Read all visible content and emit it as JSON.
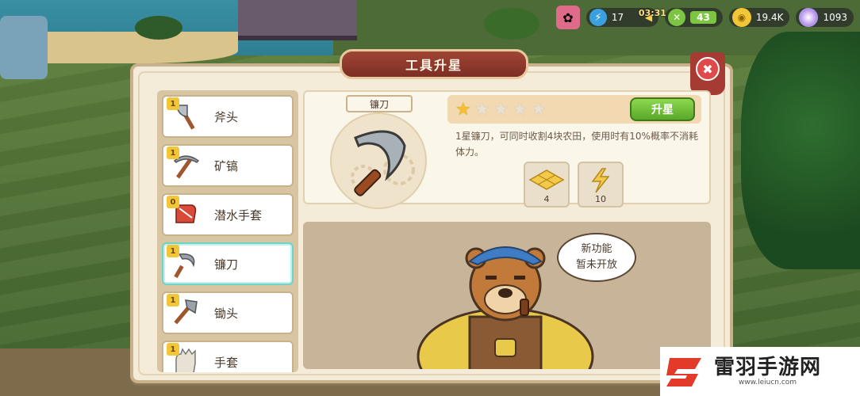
{
  "hud": {
    "energy_value": "17",
    "timer": "03:31",
    "green_value": "43",
    "coins": "19.4K",
    "gems": "1093"
  },
  "dialog": {
    "title": "工具升星",
    "close_label": "✖"
  },
  "tools": [
    {
      "name": "斧头",
      "stars": "1",
      "icon": "axe-icon"
    },
    {
      "name": "矿镐",
      "stars": "1",
      "icon": "pickaxe-icon"
    },
    {
      "name": "潜水手套",
      "stars": "0",
      "icon": "diving-glove-icon"
    },
    {
      "name": "镰刀",
      "stars": "1",
      "icon": "sickle-icon",
      "selected": true
    },
    {
      "name": "锄头",
      "stars": "1",
      "icon": "hoe-icon"
    },
    {
      "name": "手套",
      "stars": "1",
      "icon": "glove-icon"
    }
  ],
  "detail": {
    "tool_name": "镰刀",
    "stars_filled": 1,
    "stars_total": 5,
    "upgrade_label": "升星",
    "description": "1星镰刀，可同时收割4块农田，使用时有10%概率不消耗体力。",
    "materials": [
      {
        "icon": "farmland-tiles-icon",
        "count": "4"
      },
      {
        "icon": "energy-bolt-icon",
        "count": "10"
      }
    ]
  },
  "bear_panel": {
    "speech_line1": "新功能",
    "speech_line2": "暂未开放"
  },
  "logo": {
    "name": "雷羽手游网",
    "url": "www.leiucn.com"
  },
  "colors": {
    "title_banner": "#8e3a2d",
    "upgrade_button": "#6cbf34",
    "star_filled": "#f6c02c",
    "dialog_bg": "#f4ecd9"
  }
}
